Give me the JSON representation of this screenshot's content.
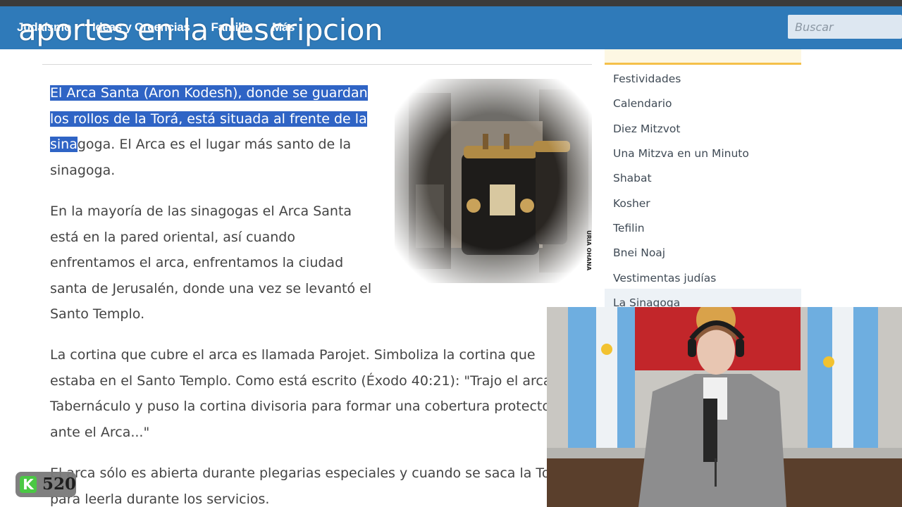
{
  "overlay_title": "aportes en la descripcion",
  "nav": {
    "items": [
      "Judaísmo",
      "Ideas y Creencias",
      "Familia",
      "Más"
    ]
  },
  "search": {
    "placeholder": "Buscar"
  },
  "article": {
    "p1": [
      "El Arca Santa (Aron Kodesh), donde se guardan",
      "los rollos de la Torá, está situada al frente de la",
      "sina",
      "goga. El Arca es el lugar más santo de la",
      "sinagoga."
    ],
    "p2": [
      "En la mayoría de las sinagogas el Arca Santa",
      "está en la pared oriental, así cuando",
      "enfrentamos el arca, enfrentamos la ciudad",
      "santa de Jerusalén, donde una vez se levantó el",
      "Santo Templo."
    ],
    "p3": [
      "La cortina que cubre el arca es llamada Parojet. Simboliza la cortina que",
      "estaba en el Santo Templo. Como está escrito (Éxodo 40:21): \"Trajo el arca al",
      "Tabernáculo y puso la cortina divisoria para formar una cobertura protectora",
      "ante el Arca...\""
    ],
    "p4": [
      "El arca sólo es abierta durante plegarias especiales y cuando se saca la Torá",
      "para leerla durante los servicios."
    ],
    "image_credit": "URIA OHANA"
  },
  "sidebar": {
    "items": [
      "Festividades",
      "Calendario",
      "Diez Mitzvot",
      "Una Mitzva en un Minuto",
      "Shabat",
      "Kosher",
      "Tefilin",
      "Bnei Noaj",
      "Vestimentas judías",
      "La Sinagoga"
    ]
  },
  "badge": {
    "letter": "K",
    "count": "520"
  },
  "colors": {
    "navbar": "#2f7ab9",
    "highlight": "#2f64c5",
    "sidebar_accent": "#f5c04a"
  }
}
